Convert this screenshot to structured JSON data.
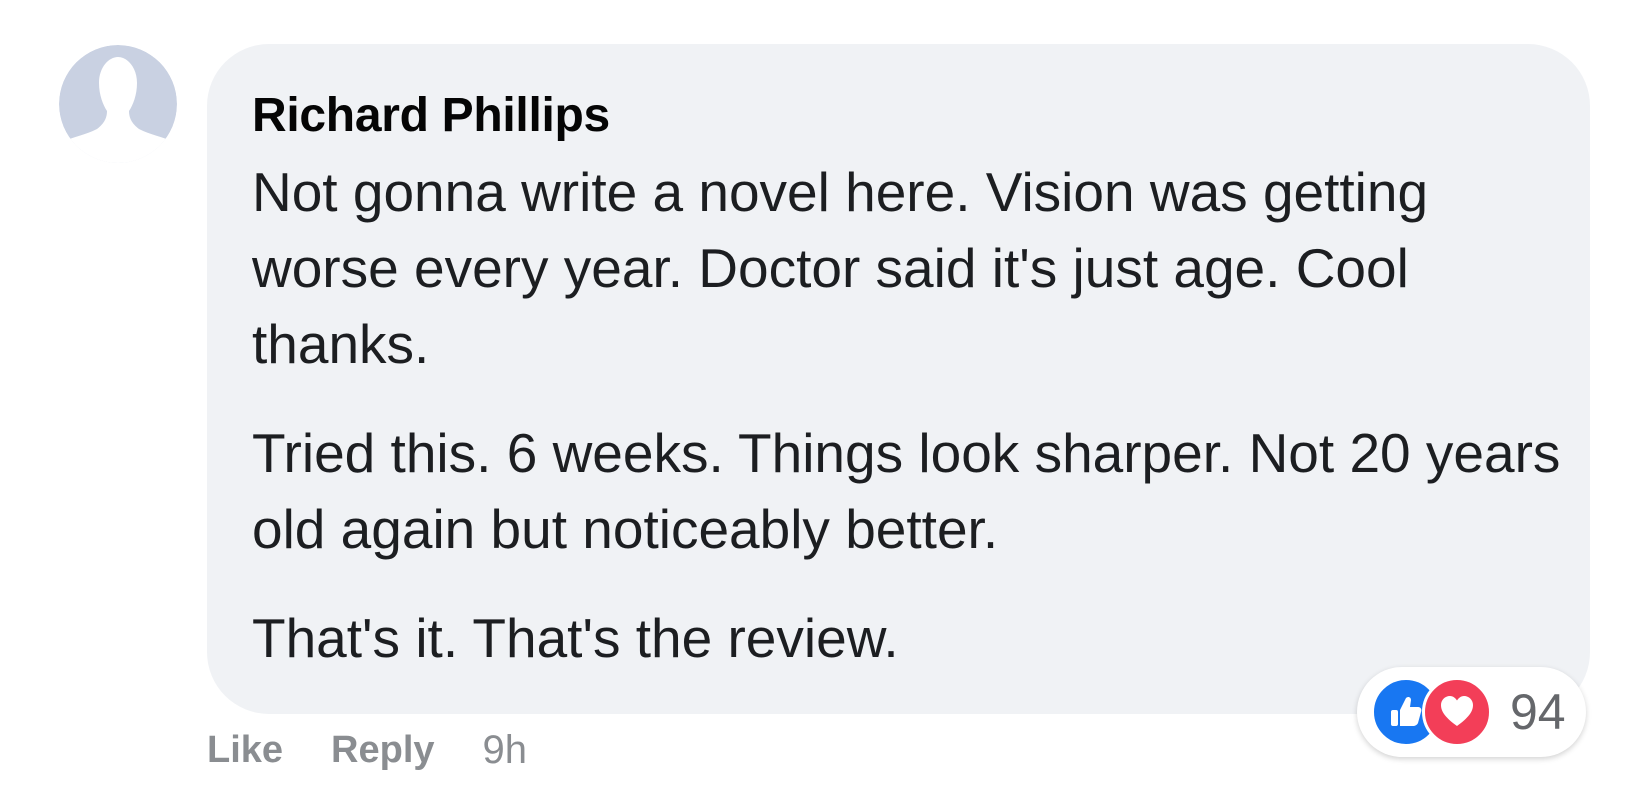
{
  "comment": {
    "author": "Richard Phillips",
    "paragraphs": [
      "Not gonna write a novel here. Vision was getting worse every year. Doctor said it's just age. Cool thanks.",
      "Tried this. 6 weeks. Things look sharper. Not 20 years old again but noticeably better.",
      "That's it. That's the review."
    ],
    "actions": {
      "like_label": "Like",
      "reply_label": "Reply",
      "timestamp": "9h"
    },
    "reactions": {
      "count": "94",
      "icons": [
        "thumbs-up-icon",
        "heart-icon"
      ]
    }
  },
  "colors": {
    "bubble_background": "#f0f2f5",
    "avatar_background": "#c9d1e2",
    "like_blue": "#1877f2",
    "love_red": "#f33e58",
    "muted_text": "#8a8d91"
  }
}
